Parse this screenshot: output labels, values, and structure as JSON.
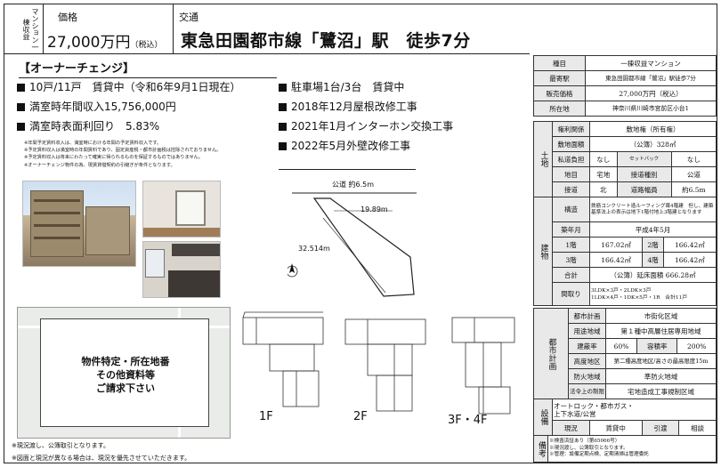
{
  "header": {
    "tag": "マンション一棟収益",
    "price_caption": "価格",
    "price": "27,000万円",
    "price_tax": "（税込）",
    "access_caption": "交通",
    "access": "東急田園都市線「鷺沼」駅　徒歩7分"
  },
  "owner_change": "【オーナーチェンジ】",
  "bullets": {
    "b1": "10戸/11戸　賃貸中（令和6年9月1日現在）",
    "b2": "満室時年間収入15,756,000円",
    "b3": "満室時表面利回り　5.83%",
    "b4": "駐車場1台/3台　賃貸中",
    "b5": "2018年12月屋根改修工事",
    "b6": "2021年1月インターホン交換工事",
    "b7": "2022年5月外壁改修工事"
  },
  "notes": [
    "※年間予定賃料収入は、満室時における年間の予定賃料収入です。",
    "※予定賃料収入は満室時の年間賃料であり、固定資産税・都市計画税は控除されておりません。",
    "※予定賃料収入は将来にわたって確実に得られるものを保証するものではありません。",
    "※オーナーチェンジ物件の為、現賃貸借契約の引継ぎが条件となります。"
  ],
  "site_plan": {
    "road": "公道 約6.5m",
    "dim1": "19.89m",
    "dim2": "32.514m"
  },
  "map_message": {
    "l1": "物件特定・所在地番",
    "l2": "その他資料等",
    "l3": "ご請求下さい"
  },
  "floors": {
    "f1": "1F",
    "f2": "2F",
    "f3": "3F・4F"
  },
  "footer": {
    "f1": "※現況渡し、公簿取引となります。",
    "f2": "※図面と現況が異なる場合は、現況を優先させていただきます。"
  },
  "table": {
    "type_label": "種目",
    "type": "一棟収益マンション",
    "station_label": "最寄駅",
    "station": "東急田園都市線「鷺沼」駅徒歩7分",
    "price_label": "販売価格",
    "price": "27,000万円（税込）",
    "location_label": "所在地",
    "location": "神奈川県川崎市宮前区小台1",
    "land_side": "土地",
    "rights_label": "権利関係",
    "rights": "敷地権（所有権）",
    "area_label": "敷地面積",
    "area": "（公簿）328㎡",
    "private_road_label": "私道負担",
    "private_road": "なし",
    "setback_label": "セットバック",
    "setback": "なし",
    "landuse_label": "地目",
    "landuse": "宅地",
    "road_type_label": "接道種別",
    "road_type": "公道",
    "road_dir_label": "接道",
    "road_dir": "北",
    "road_width_label": "道路幅員",
    "road_width": "約6.5m",
    "bldg_side": "建物",
    "structure_label": "構造",
    "structure": "鉄筋コンクリート造ルーフィング葺4階建　但し、建築基準法上の表示は地下1階付地上3階建となります",
    "built_label": "築年月",
    "built": "平成4年5月",
    "f1_label": "1階",
    "f1": "167.02㎡",
    "f2_label": "2階",
    "f2": "166.42㎡",
    "f3_label": "3階",
    "f3": "166.42㎡",
    "f4_label": "4階",
    "f4": "166.42㎡",
    "total_label": "合計",
    "total": "（公簿）延床面積 666.28㎡",
    "layout_label": "間取り",
    "layout1": "3LDK×3戸・2LDK×3戸",
    "layout2": "1LDK×4戸・1DK×5戸・1R　合計11戸",
    "city_side": "都市計画",
    "urban_label": "都市計画",
    "urban": "市街化区域",
    "zone_label": "用途地域",
    "zone": "第１種中高層住居専用地域",
    "bcr_label": "建蔽率",
    "bcr": "60%",
    "far_label": "容積率",
    "far": "200%",
    "height_label": "高度地区",
    "height": "第二種高度地区/高さの最高限度15m",
    "fire_label": "防火地域",
    "fire": "準防火地域",
    "other_label": "法令上の制限",
    "other": "宅地造成工事規制区域",
    "facility_side": "設備",
    "facility1": "オートロック・都市ガス・",
    "facility2": "上下水道/公営",
    "status_label": "現況",
    "status": "賃貸中",
    "handover_label": "引渡",
    "handover": "相談",
    "remarks_side": "備考",
    "r1": "※検査済証あり（第65066号）",
    "r2": "※現況渡し、公簿取引となります。",
    "r3": "※管理：設備定期点検、定期清掃は管理委託"
  }
}
